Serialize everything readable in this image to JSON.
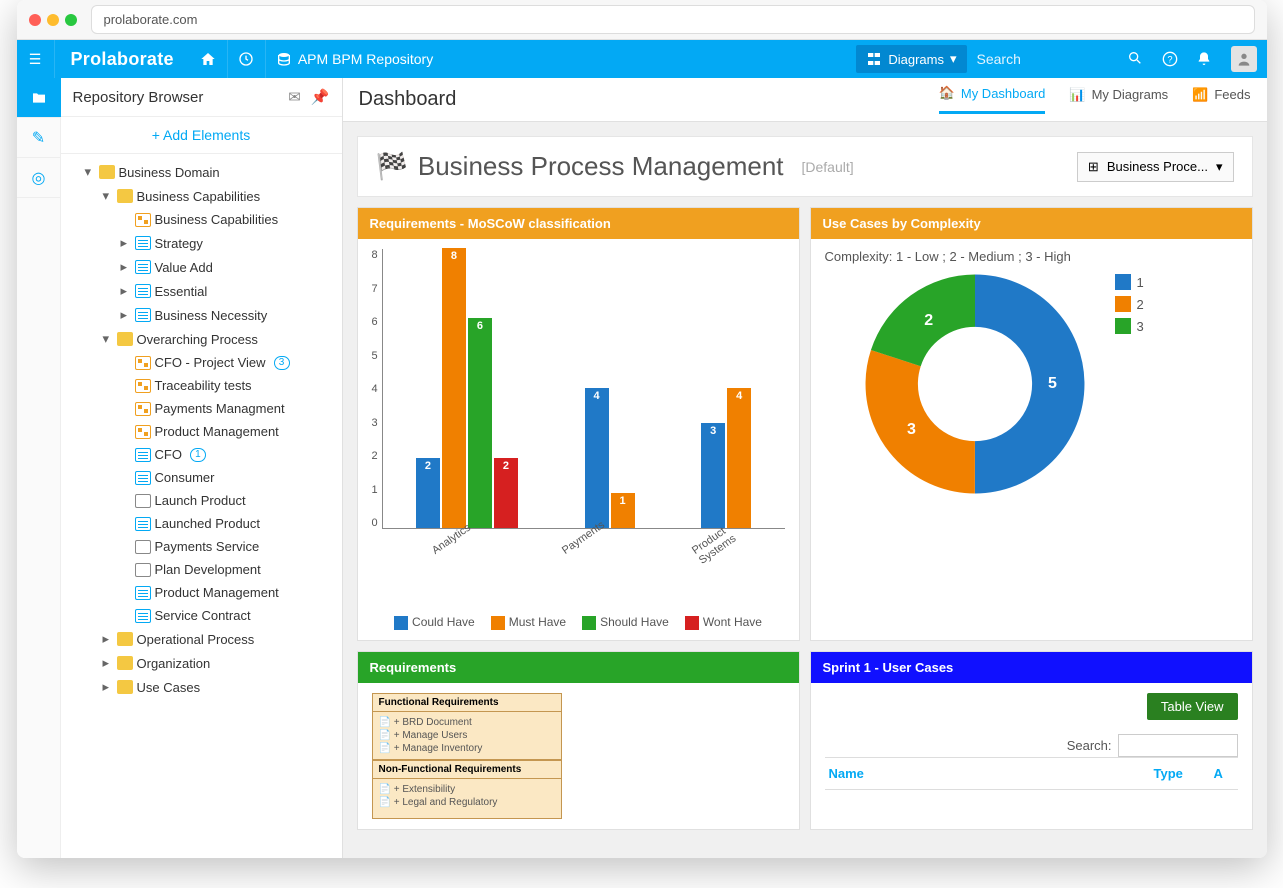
{
  "browser": {
    "url": "prolaborate.com"
  },
  "brand": "Prolaborate",
  "topbar": {
    "repository": "APM BPM Repository",
    "diagrams_btn": "Diagrams",
    "search_placeholder": "Search"
  },
  "sidebar": {
    "title": "Repository Browser",
    "add_btn": "+   Add Elements",
    "tree": {
      "root": "Business Domain",
      "capabilities": {
        "label": "Business Capabilities",
        "children": [
          "Business Capabilities",
          "Strategy",
          "Value Add",
          "Essential",
          "Business Necessity"
        ]
      },
      "overarching": {
        "label": "Overarching Process",
        "children": [
          {
            "label": "CFO - Project View",
            "badge": "3"
          },
          {
            "label": "Traceability tests"
          },
          {
            "label": "Payments Managment"
          },
          {
            "label": "Product Management"
          },
          {
            "label": "CFO",
            "badge": "1",
            "icon": "doc"
          },
          {
            "label": "Consumer",
            "icon": "doc"
          },
          {
            "label": "Launch Product",
            "icon": "comp"
          },
          {
            "label": "Launched Product",
            "icon": "doc"
          },
          {
            "label": "Payments Service",
            "icon": "comp"
          },
          {
            "label": "Plan Development",
            "icon": "comp"
          },
          {
            "label": "Product Management",
            "icon": "doc"
          },
          {
            "label": "Service Contract",
            "icon": "doc"
          }
        ]
      },
      "siblings": [
        "Operational Process",
        "Organization",
        "Use Cases"
      ]
    }
  },
  "main": {
    "page_title": "Dashboard",
    "tabs": {
      "my_dashboard": "My Dashboard",
      "my_diagrams": "My Diagrams",
      "feeds": "Feeds"
    },
    "dash_title": "Business Process Management",
    "default_tag": "[Default]",
    "selector": "Business Proce..."
  },
  "chart_data": [
    {
      "id": "moscow",
      "title": "Requirements - MoSCoW classification",
      "type": "bar",
      "categories": [
        "Analytics",
        "Payments",
        "Product Systems"
      ],
      "series": [
        {
          "name": "Could Have",
          "color": "#2079c7",
          "values": [
            2,
            4,
            3
          ]
        },
        {
          "name": "Must Have",
          "color": "#f08000",
          "values": [
            8,
            1,
            4
          ]
        },
        {
          "name": "Should Have",
          "color": "#28a428",
          "values": [
            6,
            0,
            0
          ]
        },
        {
          "name": "Wont Have",
          "color": "#d62020",
          "values": [
            2,
            0,
            0
          ]
        }
      ],
      "ylim": [
        0,
        8
      ],
      "ylabel": "",
      "xlabel": ""
    },
    {
      "id": "complexity",
      "title": "Use Cases by Complexity",
      "subtitle": "Complexity: 1 - Low ; 2 - Medium ; 3 - High",
      "type": "pie",
      "slices": [
        {
          "name": "1",
          "value": 5,
          "color": "#2079c7"
        },
        {
          "name": "2",
          "value": 3,
          "color": "#f08000"
        },
        {
          "name": "3",
          "value": 2,
          "color": "#28a428"
        }
      ]
    }
  ],
  "requirements_widget": {
    "title": "Requirements",
    "functional": {
      "header": "Functional Requirements",
      "items": [
        "+ BRD Document",
        "+ Manage Users",
        "+ Manage Inventory"
      ]
    },
    "nonfunctional": {
      "header": "Non-Functional Requirements",
      "items": [
        "+ Extensibility",
        "+ Legal and Regulatory"
      ]
    }
  },
  "sprint_widget": {
    "title": "Sprint 1 - User Cases",
    "table_view_btn": "Table View",
    "search_label": "Search:",
    "columns": [
      "Name",
      "Type",
      "A"
    ]
  }
}
